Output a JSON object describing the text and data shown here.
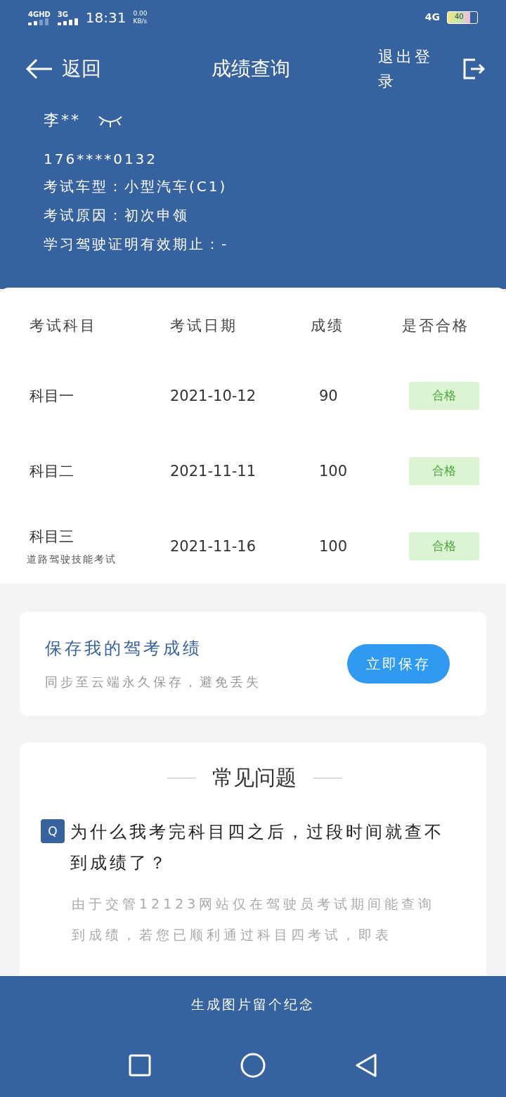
{
  "status_bar": {
    "network_1": "4GHD",
    "network_2": "3G",
    "time": "18:31",
    "speed": "0.00",
    "speed_unit": "KB/s",
    "network_right": "4G",
    "battery": "40"
  },
  "nav": {
    "back": "返回",
    "title": "成绩查询",
    "logout": "退出登录"
  },
  "profile": {
    "name": "李**",
    "phone": "176****0132",
    "lines": [
      {
        "label": "考试车型：",
        "value": "小型汽车(C1)"
      },
      {
        "label": "考试原因：",
        "value": "初次申领"
      },
      {
        "label": "学习驾驶证明有效期止：",
        "value": "-"
      }
    ]
  },
  "table": {
    "columns": [
      "考试科目",
      "考试日期",
      "成绩",
      "是否合格"
    ],
    "rows": [
      {
        "subject": "科目一",
        "date": "2021-10-12",
        "score": "90",
        "result": "合格"
      },
      {
        "subject": "科目二",
        "date": "2021-11-11",
        "score": "100",
        "result": "合格"
      },
      {
        "subject": "科目三",
        "note": "道路驾驶技能考试",
        "date": "2021-11-16",
        "score": "100",
        "result": "合格"
      }
    ]
  },
  "save_card": {
    "title": "保存我的驾考成绩",
    "subtitle": "同步至云端永久保存，避免丢失",
    "button": "立即保存"
  },
  "faq": {
    "title": "常见问题",
    "badge": "Q",
    "question": "为什么我考完科目四之后，过段时间就查不到成绩了？",
    "answer": "由于交管12123网站仅在驾驶员考试期间能查询到成绩，若您已顺利通过科目四考试，即表"
  },
  "bottom_button": "生成图片留个纪念"
}
